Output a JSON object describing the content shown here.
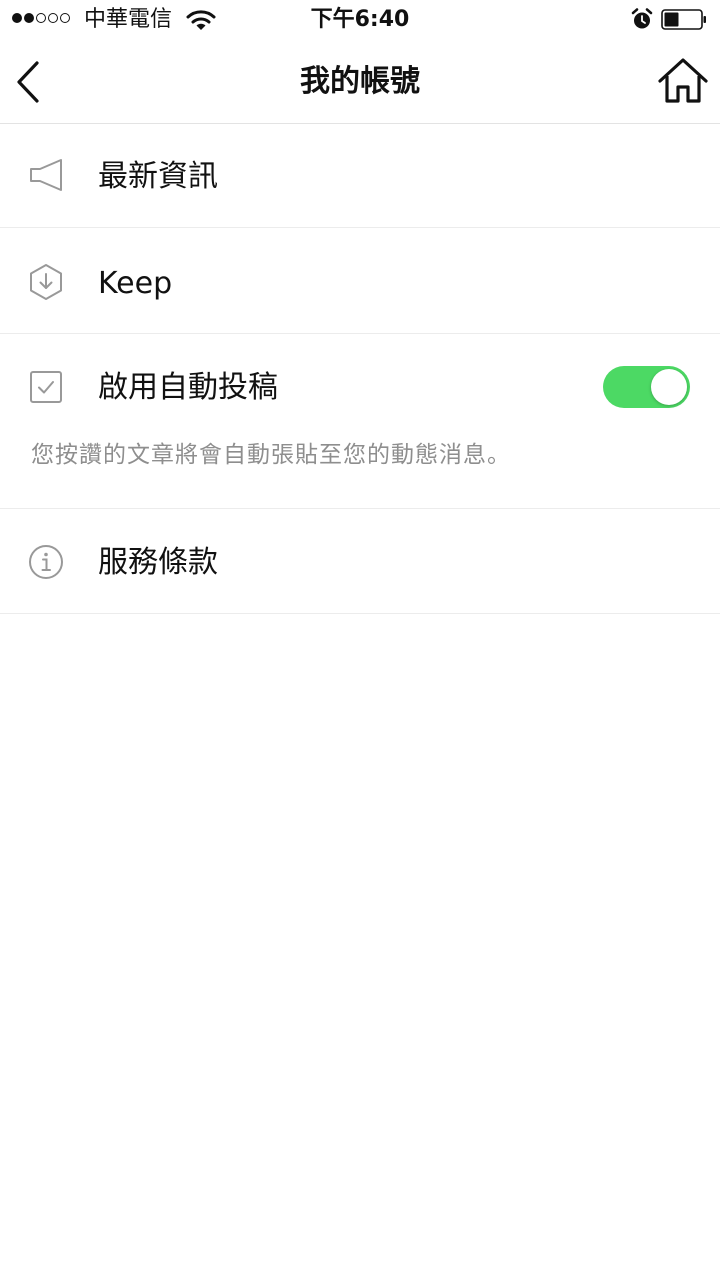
{
  "status_bar": {
    "carrier": "中華電信",
    "time": "下午6:40",
    "signal_filled": 2,
    "signal_total": 5,
    "battery_level": 0.4,
    "icons": [
      "wifi-icon",
      "alarm-icon",
      "battery-icon"
    ]
  },
  "nav": {
    "title": "我的帳號",
    "back_icon": "chevron-left-icon",
    "home_icon": "home-icon"
  },
  "menu": {
    "news": {
      "label": "最新資訊",
      "icon": "megaphone-icon"
    },
    "keep": {
      "label": "Keep",
      "icon": "keep-hexagon-icon"
    },
    "auto_post": {
      "label": "啟用自動投稿",
      "icon": "checkbox-icon",
      "description": "您按讚的文章將會自動張貼至您的動態消息。",
      "enabled": true
    },
    "terms": {
      "label": "服務條款",
      "icon": "info-icon"
    }
  },
  "colors": {
    "toggle_on": "#4cd964",
    "icon_gray": "#999999",
    "description_gray": "#8e8e8e",
    "divider": "#ececec"
  }
}
